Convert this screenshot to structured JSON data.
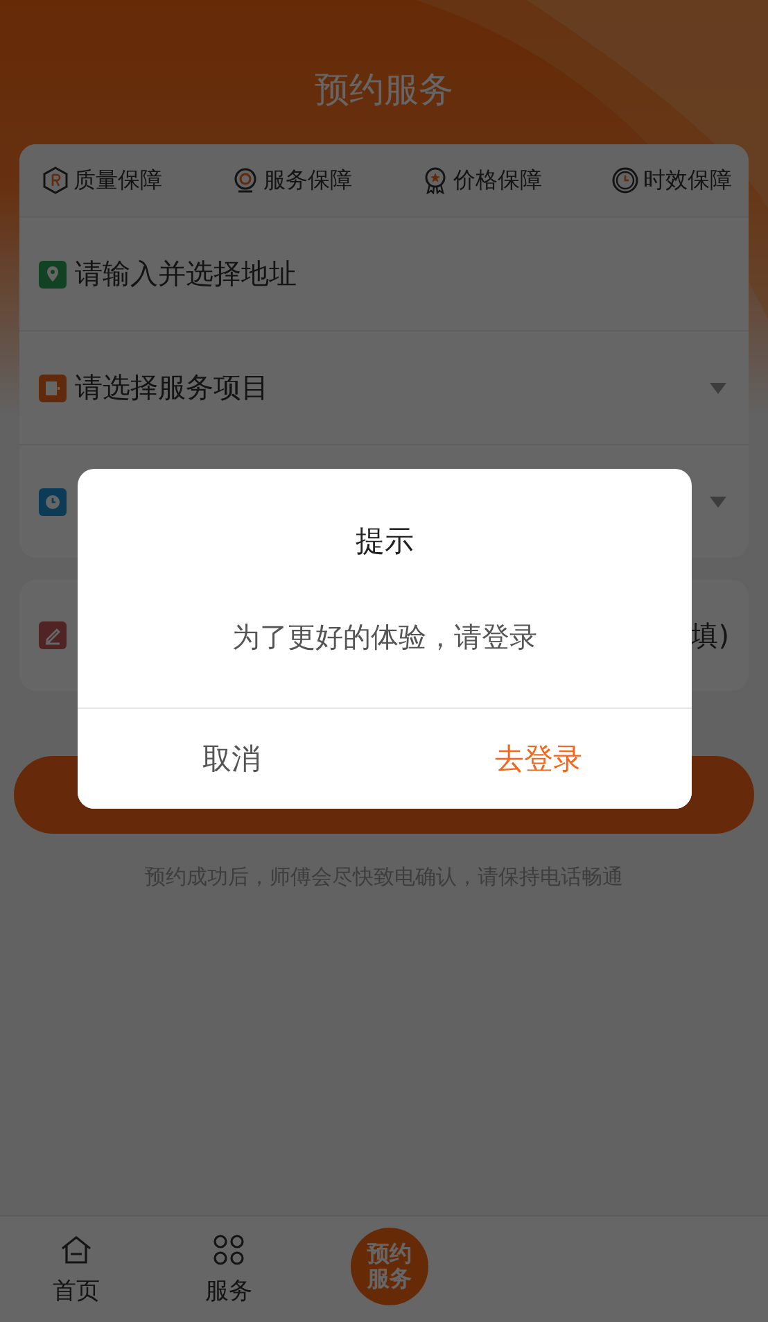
{
  "header": {
    "title": "预约服务"
  },
  "guarantees": [
    {
      "label": "质量保障",
      "kind": "quality"
    },
    {
      "label": "服务保障",
      "kind": "service"
    },
    {
      "label": "价格保障",
      "kind": "price"
    },
    {
      "label": "时效保障",
      "kind": "time"
    }
  ],
  "form_rows": [
    {
      "kind": "address",
      "text": "请输入并选择地址",
      "dropdown": false
    },
    {
      "kind": "service",
      "text": "请选择服务项目",
      "dropdown": true
    },
    {
      "kind": "time",
      "dropdown": true
    }
  ],
  "remark": {
    "kind": "remark",
    "text_end": "填)"
  },
  "note": "预约成功后，师傅会尽快致电确认，请保持电话畅通",
  "tab_bar": [
    {
      "label": "首页",
      "kind": "home"
    },
    {
      "label": "服务",
      "kind": "service"
    },
    {
      "label": "预约服务",
      "kind": "center"
    }
  ],
  "dialog": {
    "title": "提示",
    "message": "为了更好的体验，请登录",
    "buttons": [
      {
        "label": "取消",
        "kind": "cancel"
      },
      {
        "label": "去登录",
        "kind": "confirm"
      }
    ]
  }
}
